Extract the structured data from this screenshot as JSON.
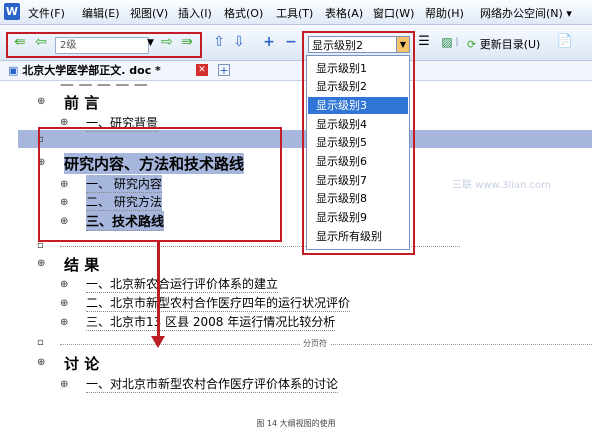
{
  "menu": {
    "items": [
      "文件(F)",
      "编辑(E)",
      "视图(V)",
      "插入(I)",
      "格式(O)",
      "工具(T)",
      "表格(A)",
      "窗口(W)",
      "帮助(H)",
      "网络办公空间(N)"
    ]
  },
  "toolbar": {
    "level_value": "2级",
    "show_level_value": "显示级别2",
    "update_toc_label": "更新目录(U)"
  },
  "tab": {
    "doc_name": "北京大学医学部正文. doc *"
  },
  "dropdown": {
    "options": [
      "显示级别1",
      "显示级别2",
      "显示级别3",
      "显示级别4",
      "显示级别5",
      "显示级别6",
      "显示级别7",
      "显示级别8",
      "显示级别9",
      "显示所有级别"
    ],
    "highlighted_index": 2
  },
  "outline": {
    "h_preface": "前 言",
    "s_background": "一、研究背景",
    "h_content": "研究内容、方法和技术路线",
    "s_content_1": "一、 研究内容",
    "s_content_2": "二、 研究方法",
    "s_content_3": "三、技术路线",
    "h_results": "结 果",
    "s_results_1": "一、北京新农合运行评价体系的建立",
    "s_results_2": "二、北京市新型农村合作医疗四年的运行状况评价",
    "s_results_3": "三、北京市13 区县 2008 年运行情况比较分析",
    "page_break": "分页符",
    "h_discussion": "讨 论",
    "s_discussion_1": "一、对北京市新型农村合作医疗评价体系的讨论"
  },
  "watermark": "三联 www.3lian.com",
  "caption": "图 14   大纲视图的使用"
}
